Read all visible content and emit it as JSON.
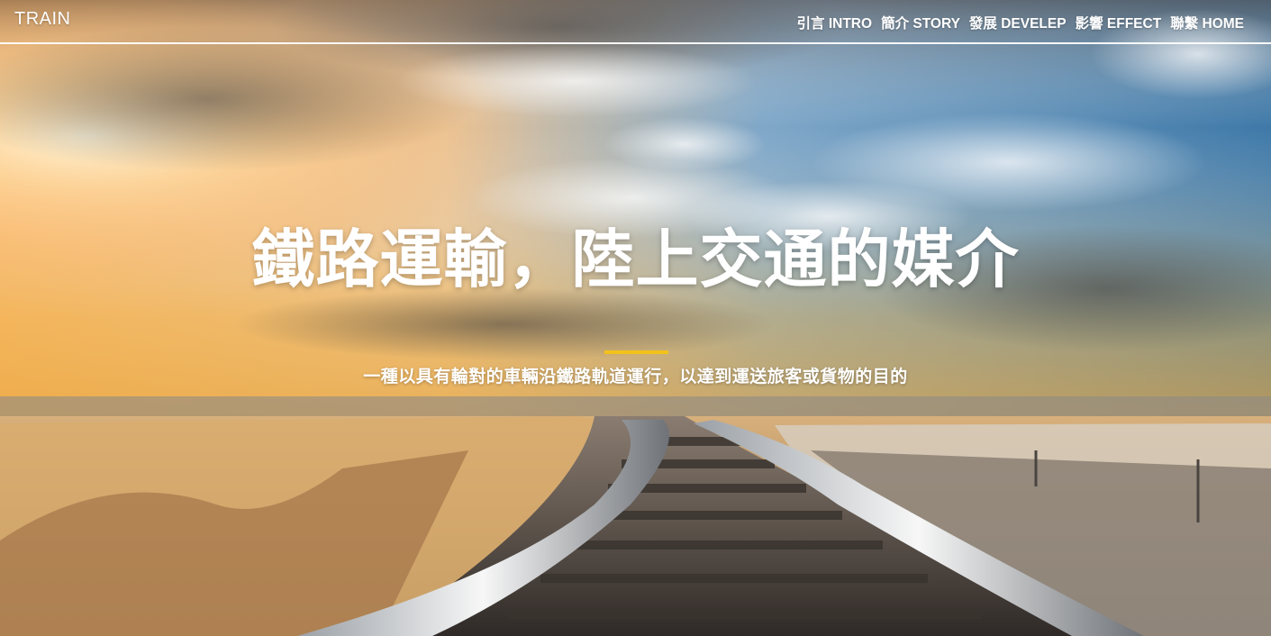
{
  "brand": "TRAIN",
  "nav": [
    {
      "label": "引言 INTRO"
    },
    {
      "label": "簡介 STORY"
    },
    {
      "label": "發展 DEVELEP"
    },
    {
      "label": "影響 EFFECT"
    },
    {
      "label": "聯繫 HOME"
    }
  ],
  "hero": {
    "title": "鐵路運輸，陸上交通的媒介",
    "subtitle": "一種以具有輪對的車輛沿鐵路軌道運行，以達到運送旅客或貨物的目的",
    "background_icon": "railway-sunset-photo"
  },
  "colors": {
    "accent": "#f2c21b",
    "text": "#ffffff"
  }
}
